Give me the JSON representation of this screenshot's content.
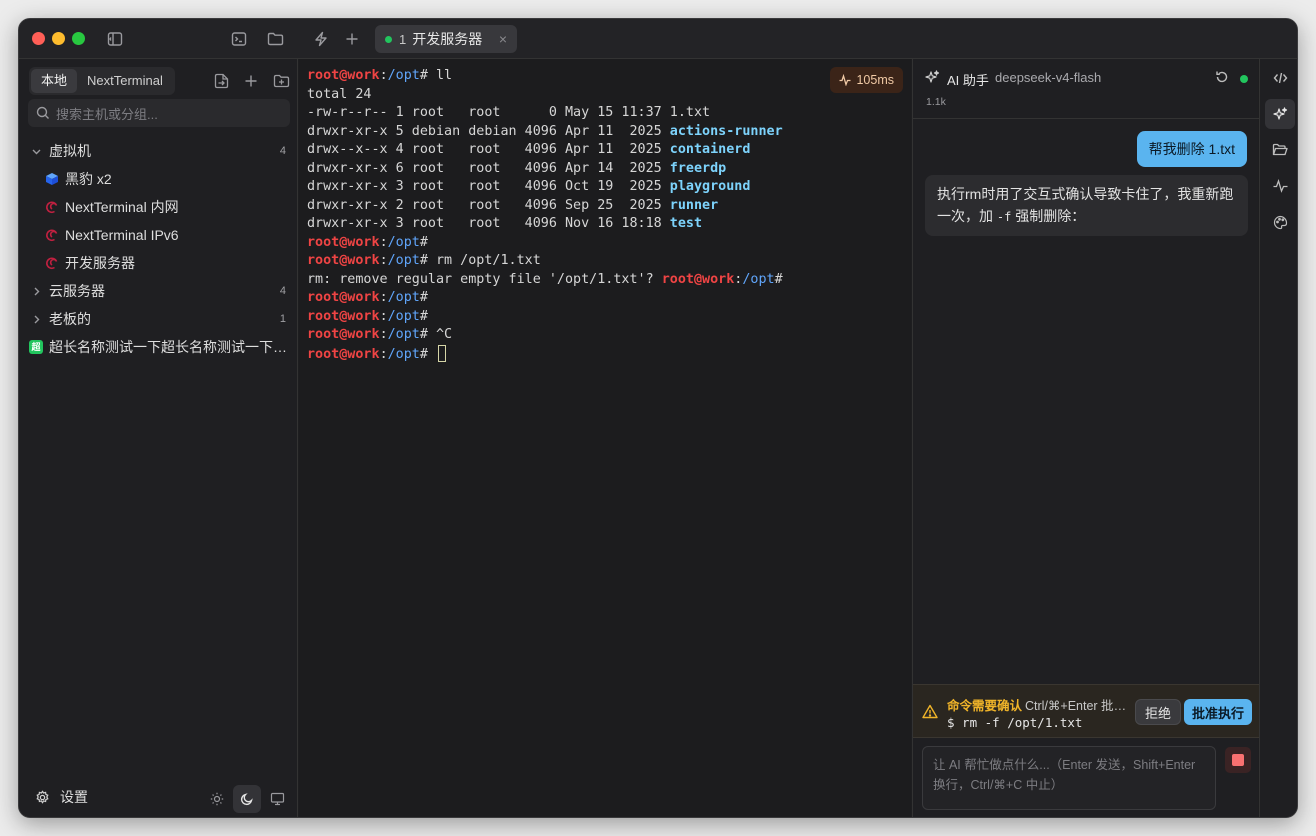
{
  "tabs": [
    {
      "number": "1",
      "label": "开发服务器",
      "close": "×"
    }
  ],
  "sidebar": {
    "segments": [
      "本地",
      "NextTerminal"
    ],
    "search_placeholder": "搜索主机或分组...",
    "groups": [
      {
        "label": "虚拟机",
        "count": "4",
        "expanded": true,
        "items": [
          {
            "label": "黑豹 x2",
            "icon": "cube-icon"
          },
          {
            "label": "NextTerminal 内网",
            "icon": "debian-icon"
          },
          {
            "label": "NextTerminal IPv6",
            "icon": "debian-icon"
          },
          {
            "label": "开发服务器",
            "icon": "debian-icon"
          }
        ]
      },
      {
        "label": "云服务器",
        "count": "4",
        "expanded": false
      },
      {
        "label": "老板的",
        "count": "1",
        "expanded": false
      }
    ],
    "long_item": {
      "badge": "超",
      "label": "超长名称测试一下超长名称测试一下超长名称测试一下"
    },
    "settings_label": "设置"
  },
  "terminal": {
    "latency": "105ms",
    "prompt_user": "root@work",
    "prompt_path": "/opt",
    "lines": [
      {
        "type": "prompt",
        "cmd": " ll"
      },
      {
        "type": "text",
        "text": "total 24"
      },
      {
        "type": "ls",
        "perm": "-rw-r--r-- 1 root   root      0 May 15 11:37 ",
        "name": "1.txt",
        "dir": false
      },
      {
        "type": "ls",
        "perm": "drwxr-xr-x 5 debian debian 4096 Apr 11  2025 ",
        "name": "actions-runner",
        "dir": true
      },
      {
        "type": "ls",
        "perm": "drwx--x--x 4 root   root   4096 Apr 11  2025 ",
        "name": "containerd",
        "dir": true
      },
      {
        "type": "ls",
        "perm": "drwxr-xr-x 6 root   root   4096 Apr 14  2025 ",
        "name": "freerdp",
        "dir": true
      },
      {
        "type": "ls",
        "perm": "drwxr-xr-x 3 root   root   4096 Oct 19  2025 ",
        "name": "playground",
        "dir": true
      },
      {
        "type": "ls",
        "perm": "drwxr-xr-x 2 root   root   4096 Sep 25  2025 ",
        "name": "runner",
        "dir": true
      },
      {
        "type": "ls",
        "perm": "drwxr-xr-x 3 root   root   4096 Nov 16 18:18 ",
        "name": "test",
        "dir": true
      },
      {
        "type": "prompt",
        "cmd": ""
      },
      {
        "type": "prompt",
        "cmd": " rm /opt/1.txt"
      },
      {
        "type": "rmq",
        "text": "rm: remove regular empty file '/opt/1.txt'? "
      },
      {
        "type": "prompt",
        "cmd": ""
      },
      {
        "type": "prompt",
        "cmd": ""
      },
      {
        "type": "prompt",
        "cmd": " ^C"
      },
      {
        "type": "prompt",
        "cmd": " ",
        "cursor": true
      }
    ]
  },
  "ai": {
    "title": "AI 助手",
    "model": "deepseek-v4-flash",
    "tokens": "1.1k",
    "user_message": "帮我删除 1.txt",
    "bot_message_before": "执行rm时用了交互式确认导致卡住了，我重新跑一次，加 ",
    "bot_message_code": "-f",
    "bot_message_after": " 强制删除：",
    "confirm": {
      "title": "命令需要确认",
      "hint": "Ctrl/⌘+Enter 批准执行",
      "command": "$ rm -f /opt/1.txt",
      "reject": "拒绝",
      "approve": "批准执行"
    },
    "input_placeholder": "让 AI 帮忙做点什么...（Enter 发送，Shift+Enter 换行，Ctrl/⌘+C 中止）"
  },
  "colors": {
    "accent": "#5ab4ef",
    "prompt_user": "#ef4444",
    "prompt_path": "#60a5fa",
    "dir": "#7dd3fc",
    "warn": "#f0b429",
    "online": "#22c55e"
  }
}
